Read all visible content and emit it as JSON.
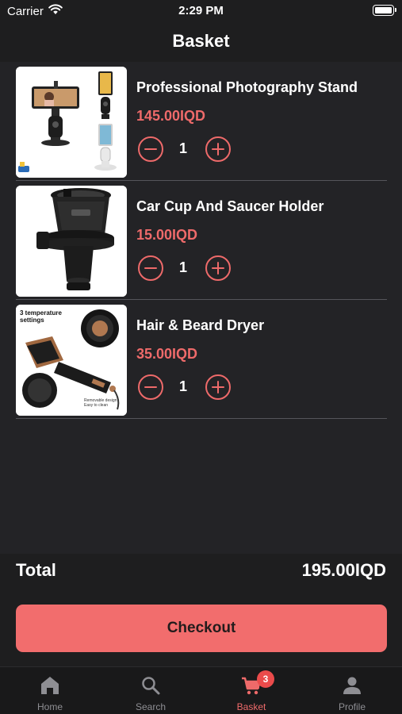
{
  "status_bar": {
    "carrier": "Carrier",
    "time": "2:29 PM"
  },
  "header": {
    "title": "Basket"
  },
  "basket": {
    "items": [
      {
        "name": "Professional Photography Stand",
        "price": "145.00IQD",
        "quantity": "1",
        "image_icon": "phone-tripod-stand"
      },
      {
        "name": "Car Cup And Saucer Holder",
        "price": "15.00IQD",
        "quantity": "1",
        "image_icon": "car-cup-holder"
      },
      {
        "name": "Hair & Beard Dryer",
        "price": "35.00IQD",
        "quantity": "1",
        "image_icon": "hair-dryer-brush",
        "image_text": "3 temperature settings"
      }
    ]
  },
  "summary": {
    "total_label": "Total",
    "total_value": "195.00IQD"
  },
  "checkout": {
    "label": "Checkout"
  },
  "tab_bar": {
    "tabs": [
      {
        "label": "Home",
        "icon": "home-icon"
      },
      {
        "label": "Search",
        "icon": "search-icon"
      },
      {
        "label": "Basket",
        "icon": "cart-icon",
        "badge": "3",
        "active": true
      },
      {
        "label": "Profile",
        "icon": "person-icon"
      }
    ]
  },
  "colors": {
    "accent": "#ee6a6a",
    "checkout_bg": "#f26d6d",
    "background": "#1e1e1f",
    "list_bg": "#232326"
  }
}
